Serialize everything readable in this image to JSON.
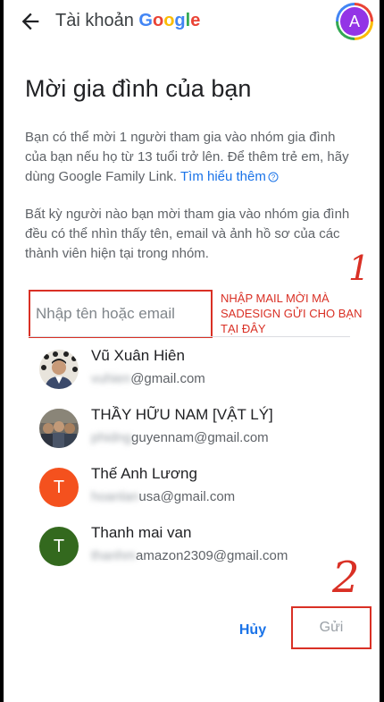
{
  "header": {
    "app_prefix": "Tài khoản",
    "brand": "Google",
    "avatar_letter": "A",
    "back_icon": "arrow-left-icon"
  },
  "title": "Mời gia đình của bạn",
  "intro": {
    "text": "Bạn có thể mời 1 người tham gia vào nhóm gia đình của bạn nếu họ từ 13 tuổi trở lên. Để thêm trẻ em, hãy dùng Google Family Link.",
    "link": "Tìm hiểu thêm",
    "help_icon": "help-circle-icon"
  },
  "notice": "Bất kỳ người nào bạn mời tham gia vào nhóm gia đình đều có thể nhìn thấy tên, email và ảnh hồ sơ của các thành viên hiện tại trong nhóm.",
  "search": {
    "placeholder": "Nhập tên hoặc email",
    "value": ""
  },
  "annotation": {
    "text": "NHẬP MAIL MỜI MÀ SADESIGN GỬI CHO BẠN TẠI ĐÂY",
    "step1": "1",
    "step2": "2"
  },
  "contacts": [
    {
      "name": "Vũ Xuân Hiên",
      "email_hidden": "vuhien",
      "email_visible": "@gmail.com",
      "avatar": "photo"
    },
    {
      "name": "THẦY HỮU NAM [VẬT LÝ]",
      "email_hidden": "phidng",
      "email_visible": "guyennam@gmail.com",
      "avatar": "photo"
    },
    {
      "name": "Thế Anh Lương",
      "email_hidden": "hoanlan",
      "email_visible": "usa@gmail.com",
      "avatar": "T",
      "color": "#f4511e"
    },
    {
      "name": "Thanh mai van",
      "email_hidden": "thanhm",
      "email_visible": "amazon2309@gmail.com",
      "avatar": "T",
      "color": "#33691e"
    }
  ],
  "actions": {
    "cancel": "Hủy",
    "send": "Gửi"
  },
  "colors": {
    "accent": "#1a73e8",
    "annotation": "#d93025",
    "avatar_top": "#9334e6"
  }
}
